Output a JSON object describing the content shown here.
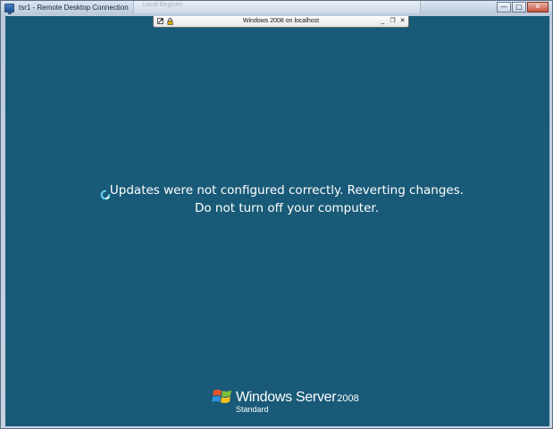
{
  "window": {
    "title": "tsr1 - Remote Desktop Connection",
    "background_tab_title": "Local Register",
    "controls": {
      "minimize_glyph": "—",
      "maximize_glyph": "□",
      "close_glyph": "✕"
    }
  },
  "connection_bar": {
    "title": "Windows 2008 on localhost",
    "icons": [
      "pin-icon",
      "lock-icon"
    ],
    "controls": {
      "minimize_glyph": "_",
      "restore_glyph": "❐",
      "close_glyph": "✕"
    }
  },
  "remote_screen": {
    "background_color": "#195a78",
    "message_line1": "Updates were not configured correctly.  Reverting changes.",
    "message_line2": "Do not turn off your computer.",
    "spinner_icon": "busy-spinner-icon",
    "branding": {
      "product_name": "Windows Server",
      "version": "2008",
      "edition": "Standard"
    }
  }
}
